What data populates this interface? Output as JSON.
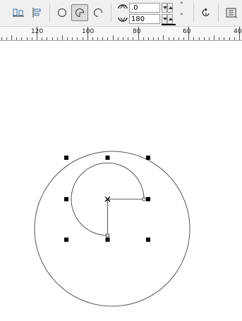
{
  "toolbar": {
    "start_angle_value": ".0",
    "end_angle_value": "180",
    "start_angle_unit": "°",
    "end_angle_unit": "°",
    "icons": {
      "align": "align-icon",
      "distribute": "distribute-icon",
      "ellipse": "ellipse-icon",
      "pie": "pie-icon",
      "arc": "arc-icon",
      "start_angle": "start-angle-icon",
      "end_angle": "end-angle-icon",
      "direction": "direction-icon",
      "wrap": "wrap-icon"
    },
    "active_mode": "pie"
  },
  "ruler": {
    "labels": [
      "120",
      "100",
      "80",
      "60",
      "40"
    ]
  },
  "colors": {
    "toolbar_bg": "#f0f0f0",
    "ruler_bg": "#f7f7f7",
    "canvas_bg": "#ffffff",
    "outline": "#555555",
    "handle": "#000000"
  }
}
